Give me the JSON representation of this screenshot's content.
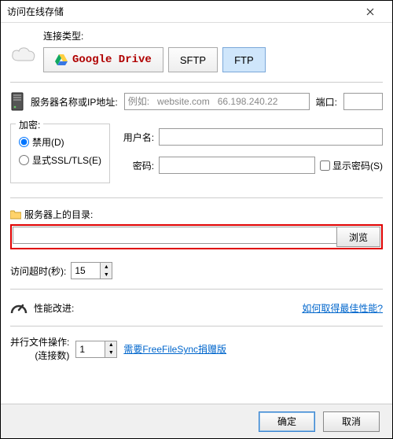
{
  "titlebar": {
    "title": "访问在线存储"
  },
  "connection": {
    "label": "连接类型:",
    "gdrive": "Google Drive",
    "sftp": "SFTP",
    "ftp": "FTP"
  },
  "server": {
    "label": "服务器名称或IP地址:",
    "placeholder": "例如:   website.com   66.198.240.22",
    "value": "",
    "port_label": "端口:",
    "port_value": ""
  },
  "encryption": {
    "legend": "加密:",
    "disabled": "禁用(D)",
    "ssl": "显式SSL/TLS(E)"
  },
  "auth": {
    "user_label": "用户名:",
    "user_value": "",
    "pass_label": "密码:",
    "pass_value": "",
    "show_pass": "显示密码(S)"
  },
  "directory": {
    "label": "服务器上的目录:",
    "value": "",
    "browse": "浏览"
  },
  "timeout": {
    "label": "访问超时(秒):",
    "value": "15"
  },
  "performance": {
    "label": "性能改进:",
    "link": "如何取得最佳性能?"
  },
  "parallel": {
    "line1": "并行文件操作:",
    "line2": "(连接数)",
    "value": "1",
    "donate": "需要FreeFileSync捐赠版"
  },
  "footer": {
    "ok": "确定",
    "cancel": "取消"
  }
}
